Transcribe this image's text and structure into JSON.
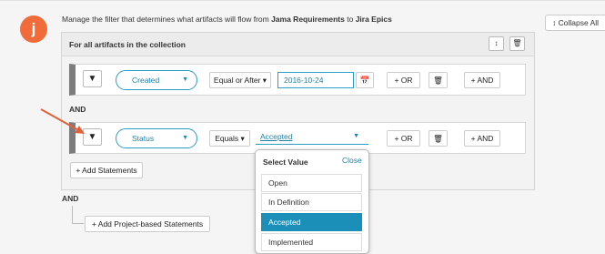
{
  "step_marker": "j",
  "description": {
    "prefix": "Manage the filter that determines what artifacts will flow from ",
    "source": "Jama Requirements",
    "middle": " to ",
    "target": "Jira Epics"
  },
  "collapse_all": "Collapse All",
  "collapse_icon": "↕",
  "collection_title": "For all artifacts in the collection",
  "icons": {
    "sort": "↕",
    "trash": "🗑",
    "filter": "▼",
    "calendar": "📅",
    "caret": "▼"
  },
  "rows": [
    {
      "field": "Created",
      "operator": "Equal or After ▾",
      "value": "2016-10-24",
      "or_label": "+ OR",
      "and_label": "+ AND"
    },
    {
      "field": "Status",
      "operator": "Equals ▾",
      "value": "Accepted",
      "or_label": "+ OR",
      "and_label": "+ AND"
    }
  ],
  "and_between": "AND",
  "add_statements": "+ Add Statements",
  "and_outer": "AND",
  "add_project_statements": "+ Add Project-based Statements",
  "dropdown": {
    "title": "Select Value",
    "close": "Close",
    "options": [
      "Open",
      "In Definition",
      "Accepted",
      "Implemented"
    ],
    "selected": "Accepted"
  },
  "colors": {
    "accent": "#2d9ec4",
    "step": "#f26b3a",
    "selected": "#1b8fb8",
    "arrow": "#e2603a"
  }
}
